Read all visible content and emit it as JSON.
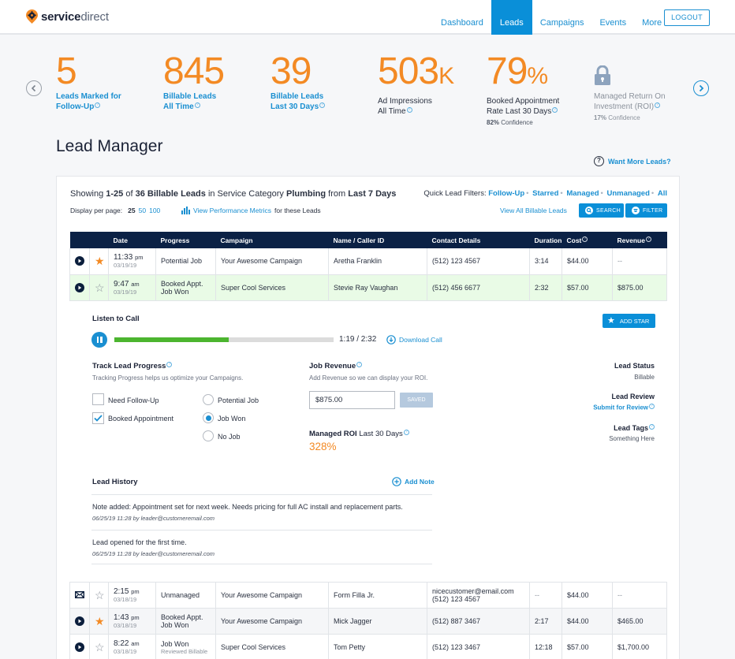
{
  "brand": {
    "name_bold": "service",
    "name_light": "direct"
  },
  "nav": {
    "items": [
      {
        "label": "Dashboard",
        "active": false
      },
      {
        "label": "Leads",
        "active": true
      },
      {
        "label": "Campaigns",
        "active": false
      },
      {
        "label": "Events",
        "active": false
      },
      {
        "label": "More",
        "active": false
      }
    ],
    "logout_label": "LOGOUT"
  },
  "stats": [
    {
      "value": "5",
      "suffix": "",
      "label_line1": "Leads Marked for",
      "label_line2": "Follow-Up",
      "confidence": ""
    },
    {
      "value": "845",
      "suffix": "",
      "label_line1": "Billable Leads",
      "label_line2": "All Time",
      "confidence": ""
    },
    {
      "value": "39",
      "suffix": "",
      "label_line1": "Billable Leads",
      "label_line2": "Last 30 Days",
      "confidence": ""
    },
    {
      "value": "503",
      "suffix": "K",
      "label_line1": "Ad Impressions",
      "label_line2": "All Time",
      "confidence": ""
    },
    {
      "value": "79",
      "suffix": "%",
      "label_line1": "Booked Appointment",
      "label_line2": "Rate Last 30 Days",
      "confidence_value": "82%",
      "confidence_label": "Confidence"
    },
    {
      "value": "",
      "suffix": "",
      "label_line1": "Managed Return On",
      "label_line2": "Investment (ROI)",
      "confidence_value": "17%",
      "confidence_label": "Confidence",
      "locked": true
    }
  ],
  "page_title": "Lead Manager",
  "want_more": "Want More Leads?",
  "summary": {
    "showing": "Showing",
    "range": "1-25",
    "of": "of",
    "count": "36 Billable Leads",
    "in": "in Service Category",
    "category": "Plumbing",
    "from": "from",
    "period": "Last 7 Days"
  },
  "per_page": {
    "label": "Display per page:",
    "current": "25",
    "options": [
      "50",
      "100"
    ]
  },
  "metrics_link": "View Performance Metrics",
  "metrics_suffix": "for these Leads",
  "quick_filters": {
    "label": "Quick Lead Filters:",
    "items": [
      "Follow-Up",
      "Starred",
      "Managed",
      "Unmanaged",
      "All"
    ]
  },
  "view_all": "View All Billable Leads",
  "search_label": "SEARCH",
  "filter_label": "FILTER",
  "table": {
    "headers": [
      "",
      "",
      "Date",
      "Progress",
      "Campaign",
      "Name / Caller ID",
      "Contact Details",
      "Duration",
      "Cost",
      "Revenue"
    ],
    "rows_top": [
      {
        "type": "call",
        "starred": true,
        "time": "11:33",
        "ampm": "pm",
        "date": "03/19/19",
        "progress": "Potential Job",
        "progress2": "",
        "campaign": "Your Awesome Campaign",
        "name": "Aretha Franklin",
        "contact": "(512) 123 4567",
        "contact2": "",
        "duration": "3:14",
        "cost": "$44.00",
        "revenue": "--",
        "style": "white"
      },
      {
        "type": "call",
        "starred": false,
        "time": "9:47",
        "ampm": "am",
        "date": "03/19/19",
        "progress": "Booked Appt.",
        "progress2": "Job Won",
        "campaign": "Super Cool Services",
        "name": "Stevie Ray Vaughan",
        "contact": "(512) 456 6677",
        "contact2": "",
        "duration": "2:32",
        "cost": "$57.00",
        "revenue": "$875.00",
        "style": "green"
      }
    ],
    "rows_bottom": [
      {
        "type": "email",
        "starred": false,
        "time": "2:15",
        "ampm": "pm",
        "date": "03/18/19",
        "progress": "Unmanaged",
        "progress2": "",
        "campaign": "Your Awesome Campaign",
        "name": "Form Filla Jr.",
        "contact": "nicecustomer@email.com",
        "contact2": "(512) 123 4567",
        "duration": "--",
        "cost": "$44.00",
        "revenue": "--",
        "style": "white"
      },
      {
        "type": "call",
        "starred": true,
        "time": "1:43",
        "ampm": "pm",
        "date": "03/18/19",
        "progress": "Booked Appt.",
        "progress2": "Job Won",
        "campaign": "Your Awesome Campaign",
        "name": "Mick Jagger",
        "contact": "(512) 887 3467",
        "contact2": "",
        "duration": "2:17",
        "cost": "$44.00",
        "revenue": "$465.00",
        "style": "gray"
      },
      {
        "type": "call",
        "starred": false,
        "time": "8:22",
        "ampm": "am",
        "date": "03/18/19",
        "progress": "Job Won",
        "progress_sub": "Reviewed Billable",
        "campaign": "Super Cool Services",
        "name": "Tom Petty",
        "contact": "(512) 123 3467",
        "contact2": "",
        "duration": "12:18",
        "cost": "$57.00",
        "revenue": "$1,700.00",
        "style": "white"
      }
    ]
  },
  "detail": {
    "listen_title": "Listen to Call",
    "playback": {
      "current": "1:19",
      "total": "2:32",
      "progress_fraction": 0.52,
      "display": "1:19 / 2:32"
    },
    "download_label": "Download Call",
    "add_star_label": "ADD STAR",
    "track_title": "Track Lead Progress",
    "track_sub": "Tracking Progress helps us optimize your Campaigns.",
    "checkboxes": [
      {
        "label": "Need Follow-Up",
        "checked": false
      },
      {
        "label": "Booked Appointment",
        "checked": true
      }
    ],
    "radios": [
      {
        "label": "Potential Job",
        "selected": false
      },
      {
        "label": "Job Won",
        "selected": true
      },
      {
        "label": "No Job",
        "selected": false
      }
    ],
    "revenue_title": "Job Revenue",
    "revenue_sub": "Add Revenue so we can display your ROI.",
    "revenue_value": "$875.00",
    "saved_label": "SAVED",
    "roi_title_bold": "Managed ROI",
    "roi_title_rest": "Last 30 Days",
    "roi_value": "328%",
    "status_title": "Lead Status",
    "status_value": "Billable",
    "review_title": "Lead Review",
    "review_link": "Submit for Review",
    "tags_title": "Lead Tags",
    "tags_value": "Something Here",
    "history_title": "Lead History",
    "add_note_label": "Add Note",
    "history": [
      {
        "text": "Note added: Appointment set for next week. Needs pricing for full AC install and replacement parts.",
        "meta": "06/25/19 11:28 by leader@customeremail.com"
      },
      {
        "text": "Lead opened for the first time.",
        "meta": "06/25/19 11:28 by leader@customeremail.com"
      }
    ]
  },
  "colors": {
    "accent": "#0a8fd8",
    "orange": "#f38a24",
    "navy": "#0b2145",
    "green": "#4cb52f",
    "green_row": "#e9fbe6"
  }
}
